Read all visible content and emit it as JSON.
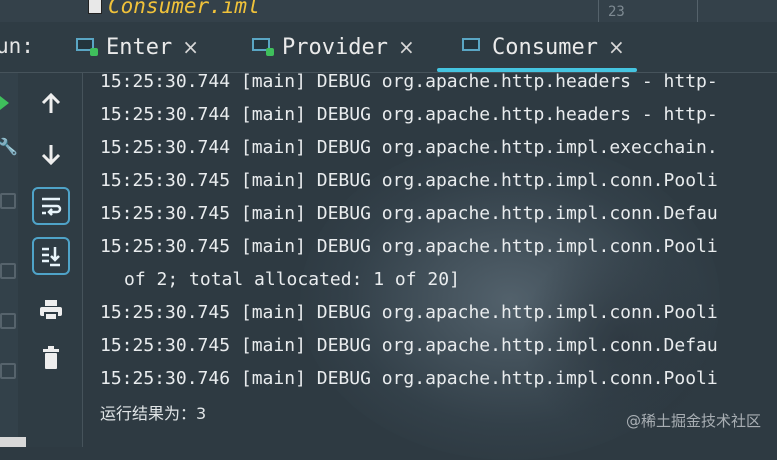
{
  "top": {
    "file_name": "Consumer.iml",
    "line_number": "23"
  },
  "run_panel": {
    "label": "un:",
    "tabs": [
      {
        "label": "Enter",
        "close": "×"
      },
      {
        "label": "Provider",
        "close": "×"
      },
      {
        "label": "Consumer",
        "close": "×",
        "active": true
      }
    ]
  },
  "toolbar": {
    "icons": [
      "arrow-up-icon",
      "arrow-down-icon",
      "soft-wrap-icon",
      "scroll-to-end-icon",
      "print-icon",
      "trash-icon"
    ]
  },
  "console": {
    "lines": [
      "15:25:30.744 [main] DEBUG org.apache.http.headers - http-",
      "15:25:30.744 [main] DEBUG org.apache.http.headers - http-",
      "15:25:30.744 [main] DEBUG org.apache.http.impl.execchain.",
      "15:25:30.745 [main] DEBUG org.apache.http.impl.conn.Pooli",
      "15:25:30.745 [main] DEBUG org.apache.http.impl.conn.Defau",
      "15:25:30.745 [main] DEBUG org.apache.http.impl.conn.Pooli",
      "of 2; total allocated: 1 of 20]",
      "15:25:30.745 [main] DEBUG org.apache.http.impl.conn.Pooli",
      "15:25:30.745 [main] DEBUG org.apache.http.impl.conn.Defau",
      "15:25:30.746 [main] DEBUG org.apache.http.impl.conn.Pooli"
    ],
    "result": "运行结果为：3"
  },
  "watermark": "@稀土掘金技术社区",
  "colors": {
    "accent": "#45c4e0",
    "run_green": "#3fbf5c",
    "file_name": "#f0c23a"
  }
}
